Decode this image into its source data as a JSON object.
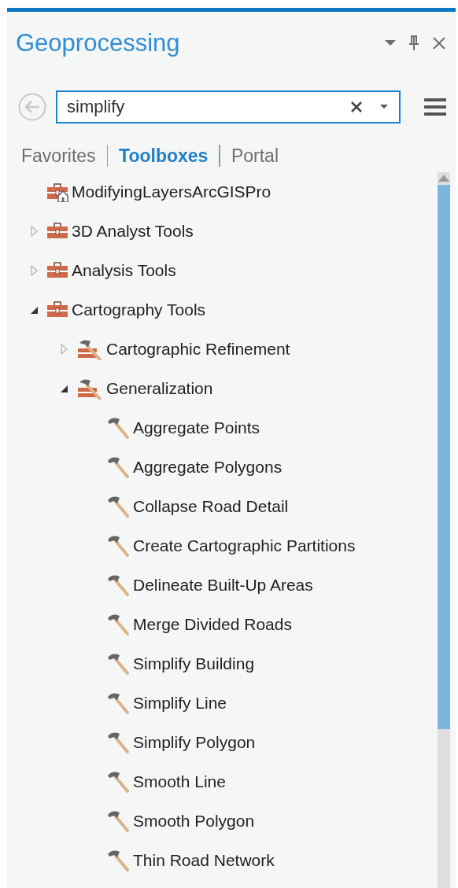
{
  "pane": {
    "title": "Geoprocessing"
  },
  "search": {
    "value": "simplify"
  },
  "tabs": [
    {
      "label": "Favorites",
      "selected": false
    },
    {
      "label": "Toolboxes",
      "selected": true
    },
    {
      "label": "Portal",
      "selected": false
    }
  ],
  "tree": [
    {
      "kind": "project-toolbox",
      "label": "ModifyingLayersArcGISPro"
    },
    {
      "kind": "toolbox",
      "label": "3D Analyst Tools",
      "expanded": false
    },
    {
      "kind": "toolbox",
      "label": "Analysis Tools",
      "expanded": false
    },
    {
      "kind": "toolbox",
      "label": "Cartography Tools",
      "expanded": true,
      "children": [
        {
          "kind": "toolset",
          "label": "Cartographic Refinement",
          "expanded": false
        },
        {
          "kind": "toolset",
          "label": "Generalization",
          "expanded": true,
          "children": [
            {
              "kind": "tool",
              "label": "Aggregate Points"
            },
            {
              "kind": "tool",
              "label": "Aggregate Polygons"
            },
            {
              "kind": "tool",
              "label": "Collapse Road Detail"
            },
            {
              "kind": "tool",
              "label": "Create Cartographic Partitions"
            },
            {
              "kind": "tool",
              "label": "Delineate Built-Up Areas"
            },
            {
              "kind": "tool",
              "label": "Merge Divided Roads"
            },
            {
              "kind": "tool",
              "label": "Simplify Building"
            },
            {
              "kind": "tool",
              "label": "Simplify Line"
            },
            {
              "kind": "tool",
              "label": "Simplify Polygon"
            },
            {
              "kind": "tool",
              "label": "Smooth Line"
            },
            {
              "kind": "tool",
              "label": "Smooth Polygon"
            },
            {
              "kind": "tool",
              "label": "Thin Road Network"
            }
          ]
        }
      ]
    }
  ]
}
